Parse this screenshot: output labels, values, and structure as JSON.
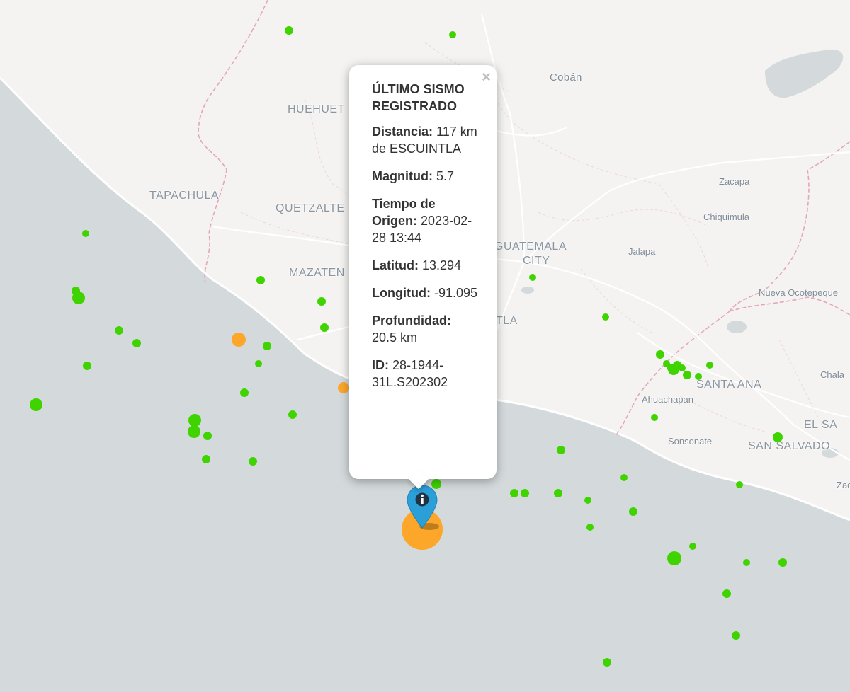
{
  "map": {
    "places": [
      {
        "id": "coban",
        "label": "Cobán",
        "class": "city"
      },
      {
        "id": "huehue",
        "label": "HUEHUET",
        "class": "major"
      },
      {
        "id": "tapachula",
        "label": "TAPACHULA",
        "class": "major"
      },
      {
        "id": "quetzal",
        "label": "QUETZALTE",
        "class": "major"
      },
      {
        "id": "zacapa",
        "label": "Zacapa",
        "class": "minor"
      },
      {
        "id": "chiquimula",
        "label": "Chiquimula",
        "class": "minor"
      },
      {
        "id": "guatemala",
        "label": "GUATEMALA",
        "class": "major"
      },
      {
        "id": "city",
        "label": "CITY",
        "class": "major"
      },
      {
        "id": "jalapa",
        "label": "Jalapa",
        "class": "minor"
      },
      {
        "id": "mazaten",
        "label": "MAZATEN",
        "class": "major"
      },
      {
        "id": "nuevaoco",
        "label": "Nueva Ocotepeque",
        "class": "minor"
      },
      {
        "id": "tla",
        "label": "TLA",
        "class": "major"
      },
      {
        "id": "santaana",
        "label": "SANTA ANA",
        "class": "major"
      },
      {
        "id": "chala",
        "label": "Chala",
        "class": "minor"
      },
      {
        "id": "ahuachapan",
        "label": "Ahuachapan",
        "class": "minor"
      },
      {
        "id": "elsa",
        "label": "EL SA",
        "class": "major"
      },
      {
        "id": "sonsonate",
        "label": "Sonsonate",
        "class": "minor"
      },
      {
        "id": "sansalvador",
        "label": "SAN SALVADO",
        "class": "major"
      },
      {
        "id": "zac",
        "label": "Zac",
        "class": "minor"
      }
    ],
    "colors": {
      "land": "#f4f3f1",
      "water": "#d4dadc",
      "quake_green": "#3fd400",
      "quake_orange": "#ffa31a",
      "marker": "#2b9fd8"
    },
    "marker_icon": "info-icon"
  },
  "popup": {
    "close_label": "×",
    "title": "ÚLTIMO SISMO REGISTRADO",
    "fields": [
      {
        "label": "Distancia:",
        "value": "117 km de ESCUINTLA"
      },
      {
        "label": "Magnitud:",
        "value": "5.7"
      },
      {
        "label": "Tiempo de Origen:",
        "value": "2023-02-28 13:44"
      },
      {
        "label": "Latitud:",
        "value": "13.294"
      },
      {
        "label": "Longitud:",
        "value": "-91.095"
      },
      {
        "label": "Profundidad:",
        "value": "20.5 km"
      },
      {
        "label": "ID:",
        "value": "28-1944-31L.S202302"
      }
    ]
  }
}
